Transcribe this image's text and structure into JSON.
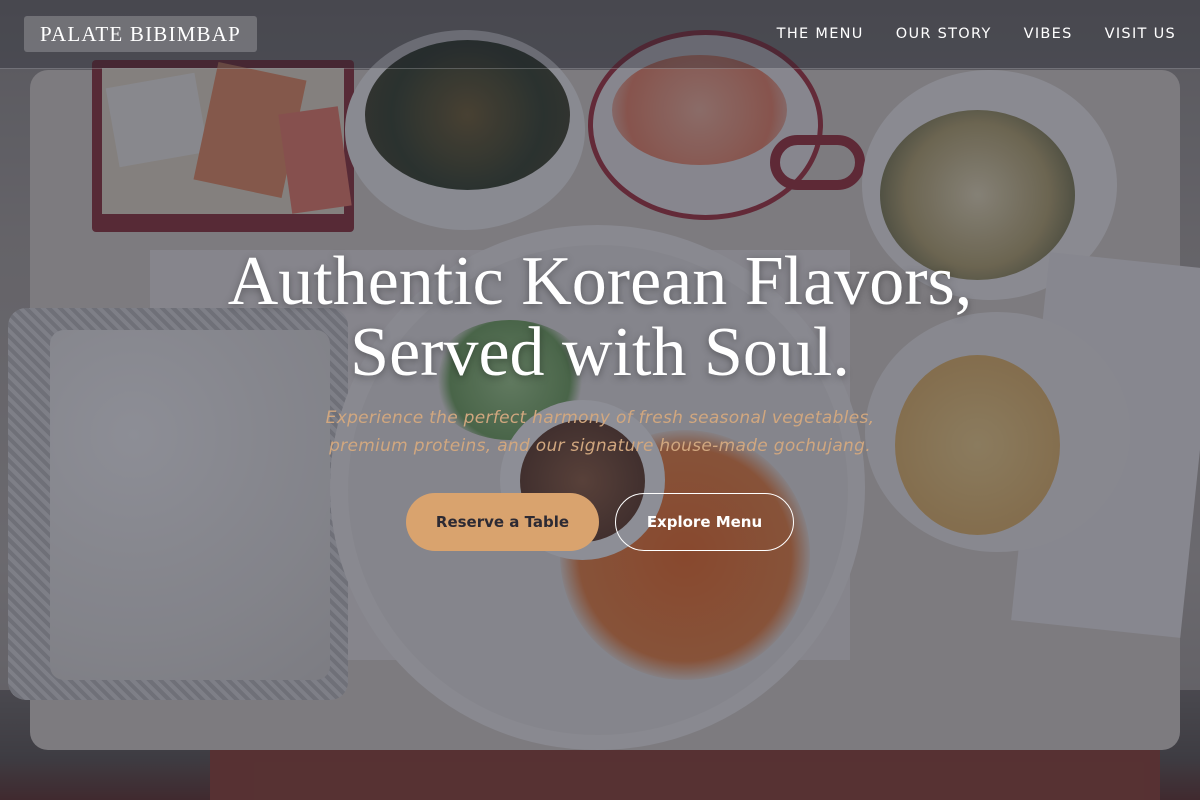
{
  "brand": {
    "name": "PALATE BIBIMBAP"
  },
  "nav": {
    "links": [
      {
        "label": "THE MENU"
      },
      {
        "label": "OUR STORY"
      },
      {
        "label": "VIBES"
      },
      {
        "label": "VISIT US"
      }
    ]
  },
  "hero": {
    "title_line1": "Authentic Korean Flavors,",
    "title_line2": "Served with Soul.",
    "subtitle_line1": "Experience the perfect harmony of fresh seasonal vegetables,",
    "subtitle_line2": "premium proteins, and our signature house-made gochujang.",
    "primary_cta": "Reserve a Table",
    "secondary_cta": "Explore Menu"
  },
  "colors": {
    "accent": "#d9a36e",
    "subtitle": "#d1a77f",
    "overlay": "#282a3a"
  }
}
